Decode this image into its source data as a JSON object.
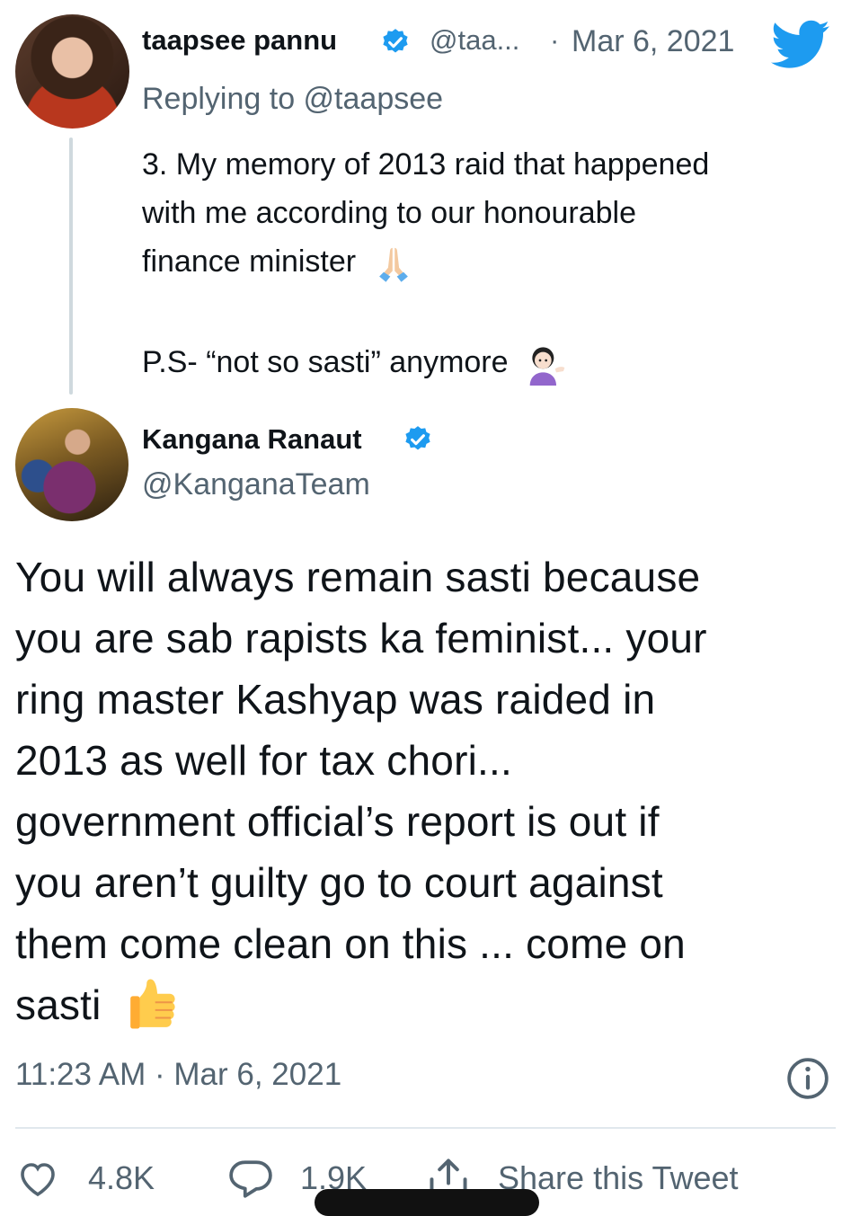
{
  "reply_tweet": {
    "display_name": "taapsee pannu",
    "handle": "@taa...",
    "separator": "·",
    "date": "Mar 6, 2021",
    "replying_to": "Replying to @taapsee",
    "text_line1": "3. My memory of 2013 raid that happened",
    "text_line2": "with me according to our honourable",
    "text_line3": "finance minister",
    "text_ps": "P.S- “not so sasti” anymore"
  },
  "main_tweet": {
    "display_name": "Kangana Ranaut",
    "handle": "@KanganaTeam",
    "lines": [
      "You will always remain sasti because",
      "you are sab rapists ka feminist... your",
      "ring master Kashyap was raided in",
      "2013 as well for tax chori...",
      "government official’s  report is out if",
      "you aren’t guilty go to court against",
      "them come clean on this ... come on",
      "sasti"
    ],
    "timestamp": "11:23 AM · Mar 6, 2021"
  },
  "actions": {
    "likes": "4.8K",
    "replies": "1.9K",
    "share_label": "Share this Tweet"
  },
  "icons": {
    "brand": "twitter-bird-icon",
    "verified": "verified-badge-icon",
    "info": "info-icon",
    "like": "heart-icon",
    "reply": "reply-bubble-icon",
    "share": "share-icon"
  },
  "colors": {
    "twitter_blue": "#1d9bf0",
    "muted": "#536471"
  }
}
